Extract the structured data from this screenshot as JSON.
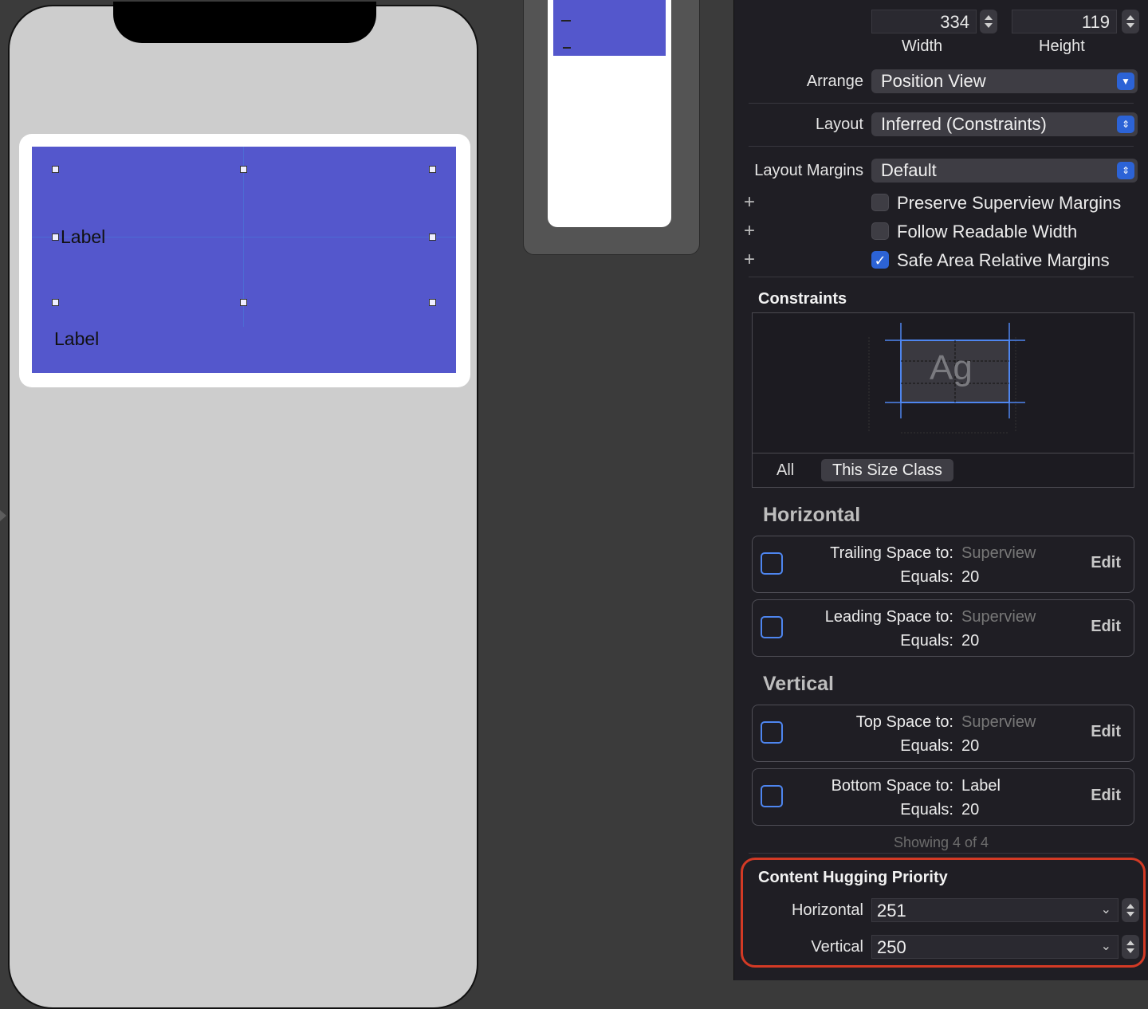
{
  "canvas": {
    "labels": [
      "Label",
      "Label"
    ]
  },
  "size": {
    "width_value": "334",
    "width_caption": "Width",
    "height_value": "119",
    "height_caption": "Height"
  },
  "arrange": {
    "label": "Arrange",
    "value": "Position View"
  },
  "layout": {
    "label": "Layout",
    "value": "Inferred (Constraints)"
  },
  "margins": {
    "label": "Layout Margins",
    "value": "Default"
  },
  "checkboxes": [
    {
      "label": "Preserve Superview Margins",
      "checked": false
    },
    {
      "label": "Follow Readable Width",
      "checked": false
    },
    {
      "label": "Safe Area Relative Margins",
      "checked": true
    }
  ],
  "constraints": {
    "title": "Constraints",
    "preview_text": "Ag",
    "segments": [
      "All",
      "This Size Class"
    ],
    "horizontal_title": "Horizontal",
    "vertical_title": "Vertical",
    "rows": [
      {
        "key1": "Trailing Space to:",
        "val1": "Superview",
        "key2": "Equals:",
        "val2": "20",
        "edit": "Edit",
        "icon": "trailing-space-icon"
      },
      {
        "key1": "Leading Space to:",
        "val1": "Superview",
        "key2": "Equals:",
        "val2": "20",
        "edit": "Edit",
        "icon": "leading-space-icon"
      },
      {
        "key1": "Top Space to:",
        "val1": "Superview",
        "key2": "Equals:",
        "val2": "20",
        "edit": "Edit",
        "icon": "top-space-icon"
      },
      {
        "key1": "Bottom Space to:",
        "val1": "Label",
        "key2": "Equals:",
        "val2": "20",
        "edit": "Edit",
        "icon": "bottom-space-icon"
      }
    ],
    "showing": "Showing 4 of 4"
  },
  "hugging": {
    "title": "Content Hugging Priority",
    "horizontal_label": "Horizontal",
    "horizontal_value": "251",
    "vertical_label": "Vertical",
    "vertical_value": "250"
  },
  "colors": {
    "view_fill": "#5457cc",
    "accent_blue": "#2c63d6",
    "highlight_red": "#d33a25"
  }
}
